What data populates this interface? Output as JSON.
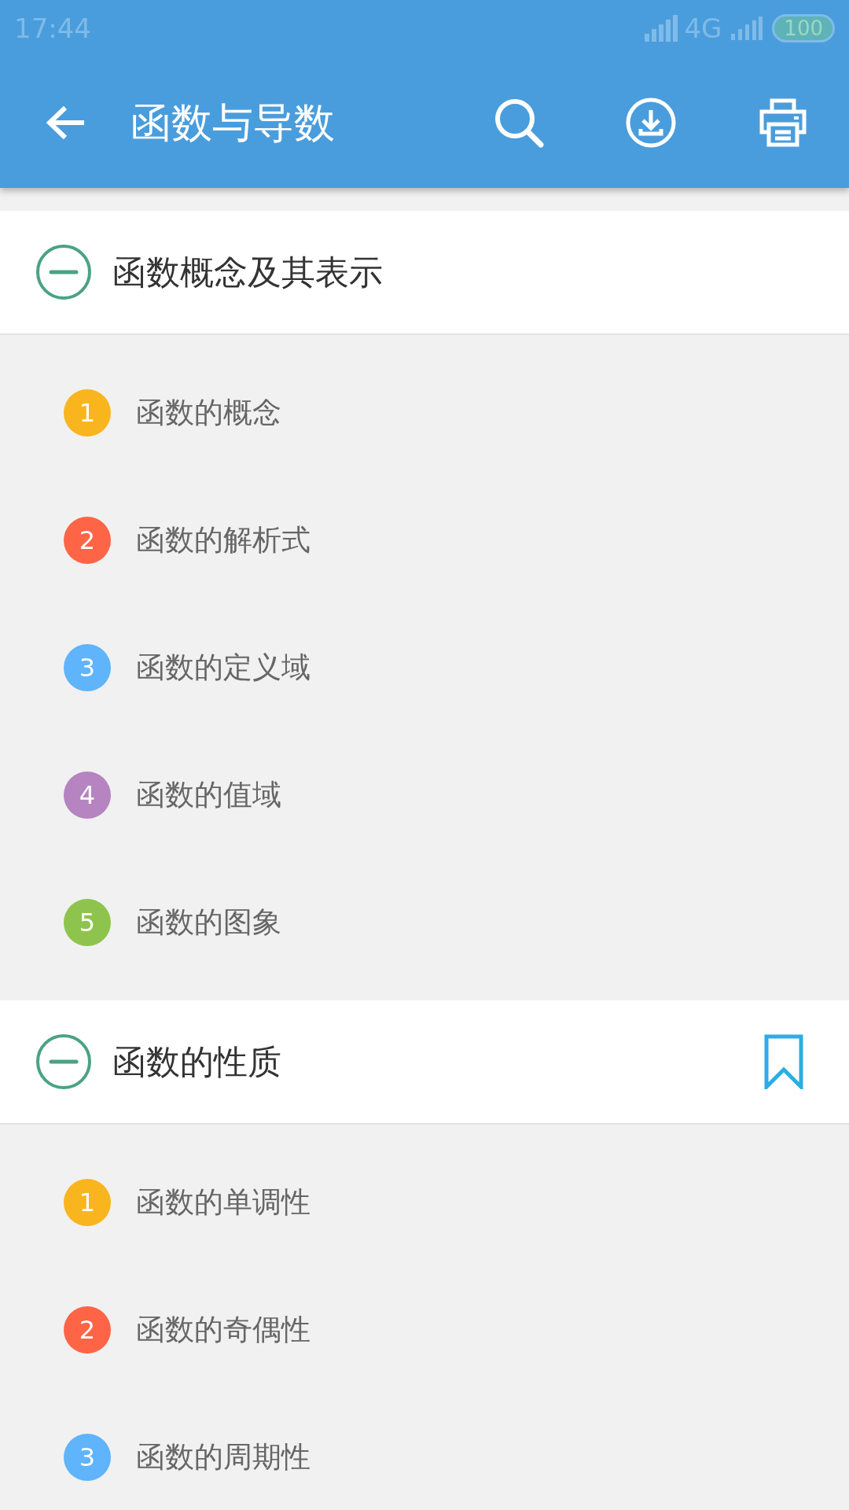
{
  "status_bar": {
    "time": "17:44",
    "network": "4G",
    "battery": "100"
  },
  "toolbar": {
    "title": "函数与导数"
  },
  "sections": [
    {
      "title": "函数概念及其表示",
      "expanded": true,
      "bookmarked": false,
      "items": [
        {
          "number": "1",
          "label": "函数的概念",
          "color": "#f9b51e"
        },
        {
          "number": "2",
          "label": "函数的解析式",
          "color": "#fe6446"
        },
        {
          "number": "3",
          "label": "函数的定义域",
          "color": "#5fb4fb"
        },
        {
          "number": "4",
          "label": "函数的值域",
          "color": "#b584c1"
        },
        {
          "number": "5",
          "label": "函数的图象",
          "color": "#8ec44d"
        }
      ]
    },
    {
      "title": "函数的性质",
      "expanded": true,
      "bookmarked": true,
      "items": [
        {
          "number": "1",
          "label": "函数的单调性",
          "color": "#f9b51e"
        },
        {
          "number": "2",
          "label": "函数的奇偶性",
          "color": "#fe6446"
        },
        {
          "number": "3",
          "label": "函数的周期性",
          "color": "#5fb4fb"
        }
      ]
    }
  ]
}
